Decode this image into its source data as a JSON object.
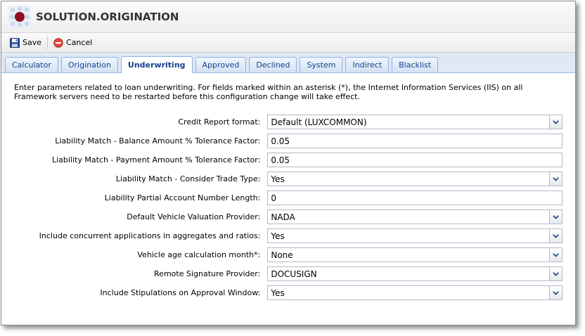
{
  "app": {
    "title": "SOLUTION.ORIGINATION",
    "logo_icon": "app-logo-icon"
  },
  "toolbar": {
    "save_label": "Save",
    "cancel_label": "Cancel"
  },
  "tabs": [
    {
      "label": "Calculator",
      "active": false
    },
    {
      "label": "Origination",
      "active": false
    },
    {
      "label": "Underwriting",
      "active": true
    },
    {
      "label": "Approved",
      "active": false
    },
    {
      "label": "Declined",
      "active": false
    },
    {
      "label": "System",
      "active": false
    },
    {
      "label": "Indirect",
      "active": false
    },
    {
      "label": "Blacklist",
      "active": false
    }
  ],
  "description": "Enter parameters related to loan underwriting. For fields marked within an asterisk (*), the Internet Information Services (IIS) on all Framework servers need to be restarted before this configuration change will take effect.",
  "fields": [
    {
      "label": "Credit Report format:",
      "value": "Default (LUXCOMMON)",
      "type": "select"
    },
    {
      "label": "Liability Match - Balance Amount % Tolerance Factor:",
      "value": "0.05",
      "type": "text"
    },
    {
      "label": "Liability Match - Payment Amount % Tolerance Factor:",
      "value": "0.05",
      "type": "text"
    },
    {
      "label": "Liability Match - Consider Trade Type:",
      "value": "Yes",
      "type": "select"
    },
    {
      "label": "Liability Partial Account Number Length:",
      "value": "0",
      "type": "text"
    },
    {
      "label": "Default Vehicle Valuation Provider:",
      "value": "NADA",
      "type": "select"
    },
    {
      "label": "Include concurrent applications in aggregates and ratios:",
      "value": "Yes",
      "type": "select"
    },
    {
      "label": "Vehicle age calculation month*:",
      "value": "None",
      "type": "select"
    },
    {
      "label": "Remote Signature Provider:",
      "value": "DOCUSIGN",
      "type": "select"
    },
    {
      "label": "Include Stipulations on Approval Window:",
      "value": "Yes",
      "type": "select"
    }
  ],
  "colors": {
    "tab_text": "#15428b",
    "tab_border": "#8db2e3",
    "tabstrip_bg": "#dfe8f5",
    "field_border": "#b5b8c8"
  }
}
